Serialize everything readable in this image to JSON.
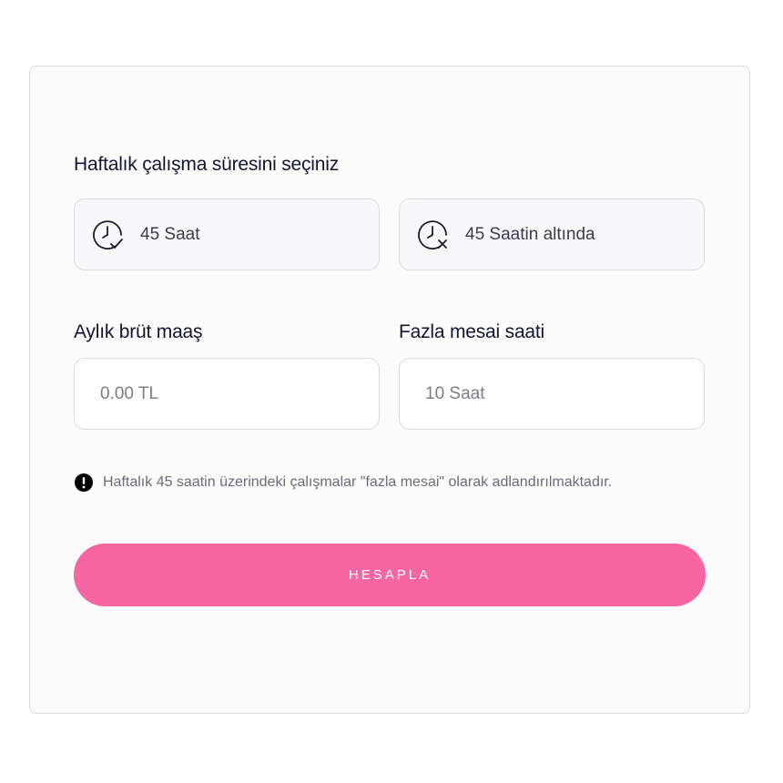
{
  "form": {
    "weekly_title": "Haftalık çalışma süresini seçiniz",
    "options": [
      {
        "label": "45 Saat",
        "icon": "clock-check-icon"
      },
      {
        "label": "45 Saatin altında",
        "icon": "clock-x-icon"
      }
    ],
    "salary": {
      "label": "Aylık brüt maaş",
      "placeholder": "0.00 TL"
    },
    "overtime": {
      "label": "Fazla mesai saati",
      "placeholder": "10 Saat"
    },
    "info": {
      "icon": "exclamation-circle-icon",
      "text": "Haftalık 45 saatin üzerindeki çalışmalar \"fazla mesai\" olarak adlandırılmaktadır."
    },
    "submit_label": "HESAPLA"
  },
  "colors": {
    "accent": "#f765a3",
    "title": "#141432",
    "border": "#dcdce0"
  }
}
